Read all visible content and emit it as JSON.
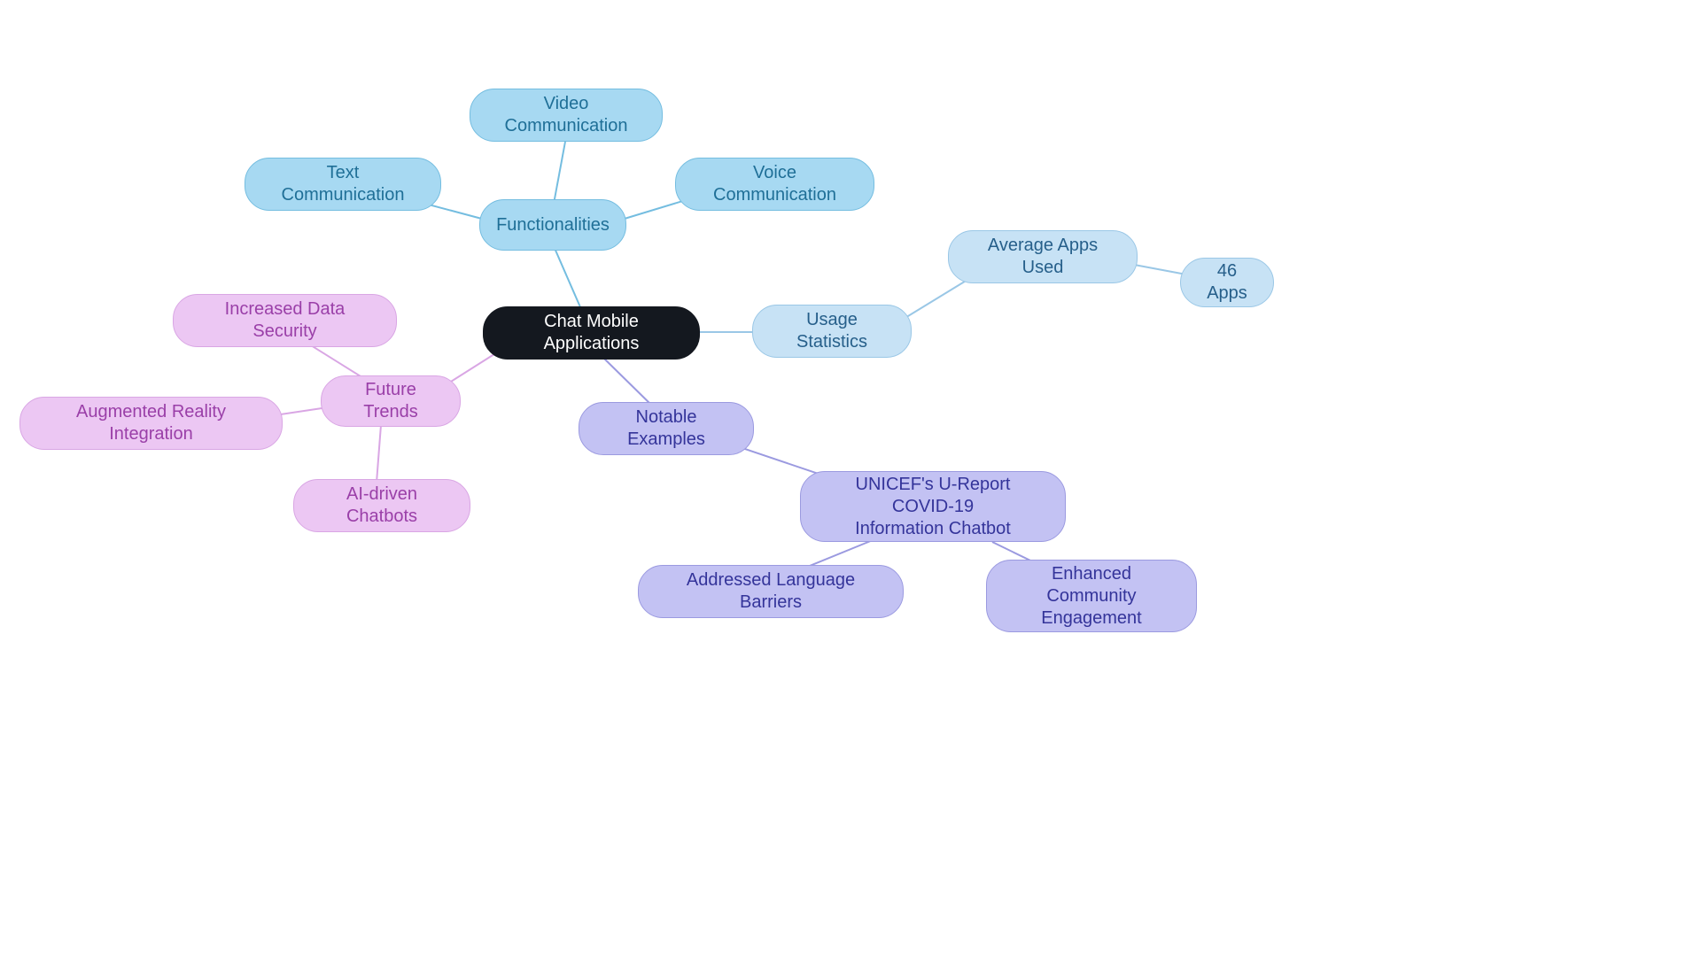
{
  "center": {
    "label": "Chat Mobile Applications"
  },
  "functionalities": {
    "root": "Functionalities",
    "text": "Text Communication",
    "video": "Video Communication",
    "voice": "Voice Communication"
  },
  "usage": {
    "root": "Usage Statistics",
    "avg": "Average Apps Used",
    "count": "46 Apps"
  },
  "notable": {
    "root": "Notable Examples",
    "unicef": "UNICEF's U-Report COVID-19\nInformation Chatbot",
    "lang": "Addressed Language Barriers",
    "engage": "Enhanced Community\nEngagement"
  },
  "future": {
    "root": "Future Trends",
    "security": "Increased Data Security",
    "ar": "Augmented Reality Integration",
    "ai": "AI-driven Chatbots"
  }
}
